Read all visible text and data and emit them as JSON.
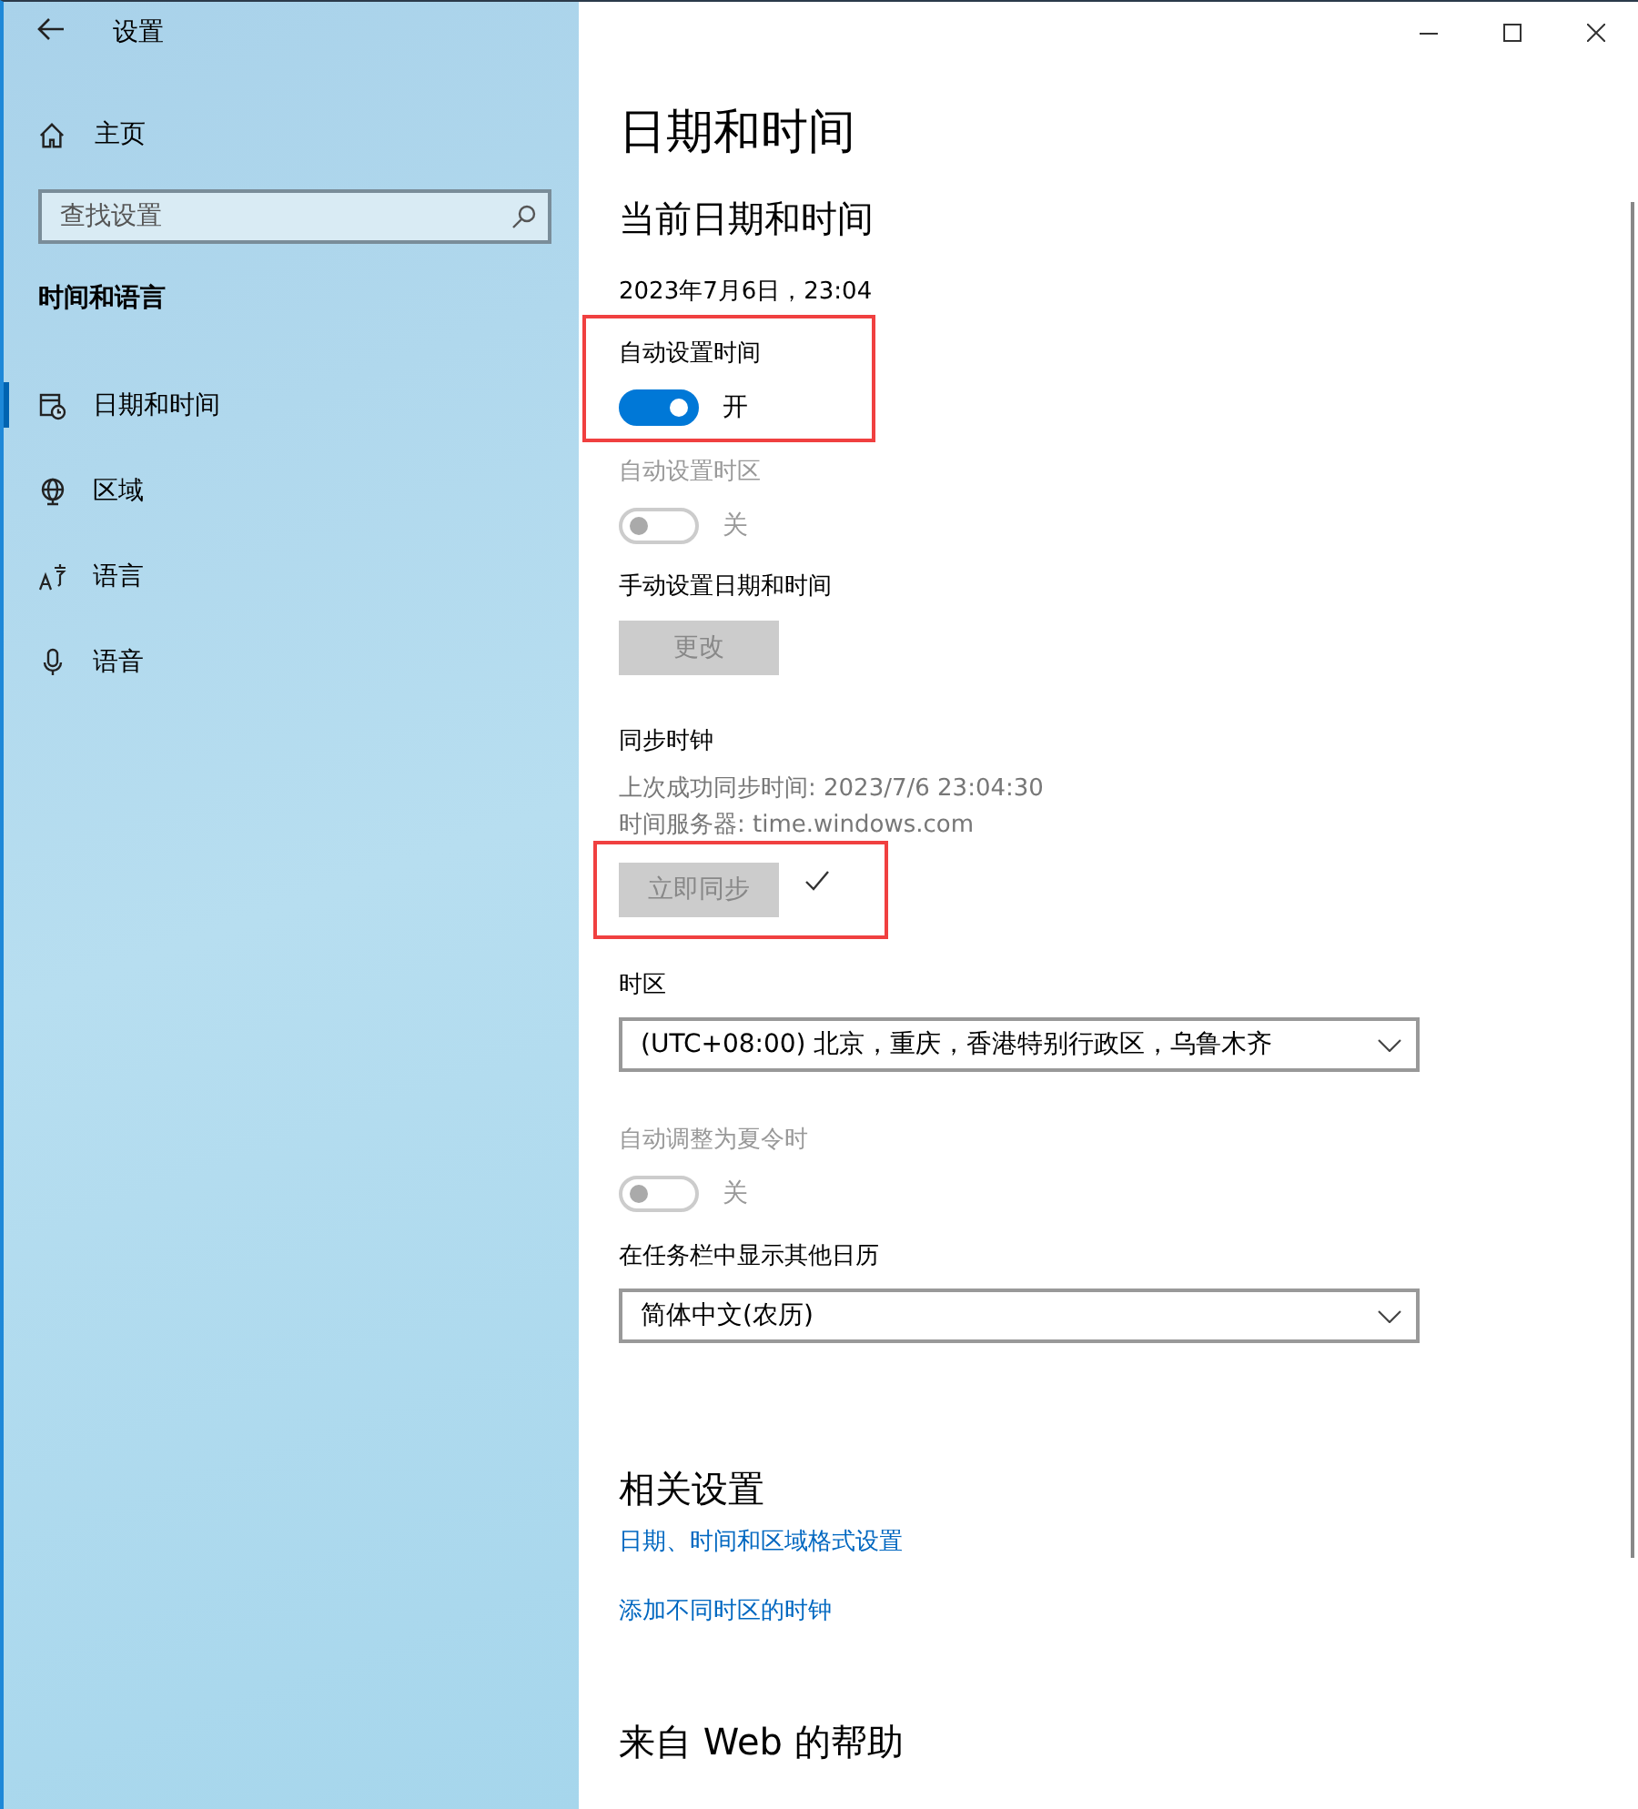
{
  "window": {
    "title": "设置"
  },
  "sidebar": {
    "home": "主页",
    "search": {
      "placeholder": "查找设置"
    },
    "section": "时间和语言",
    "items": [
      {
        "label": "日期和时间",
        "selected": true
      },
      {
        "label": "区域",
        "selected": false
      },
      {
        "label": "语言",
        "selected": false
      },
      {
        "label": "语音",
        "selected": false
      }
    ]
  },
  "page": {
    "title": "日期和时间",
    "section_title": "当前日期和时间",
    "current": "2023年7月6日，23:04",
    "settings": [
      {
        "kind": "toggle",
        "label": "自动设置时间",
        "on": true,
        "disabled": false,
        "state_text": "开",
        "highlighted": true
      },
      {
        "kind": "toggle",
        "label": "自动设置时区",
        "on": false,
        "disabled": true,
        "state_text": "关"
      },
      {
        "kind": "button",
        "label": "手动设置日期和时间",
        "button": "更改",
        "disabled": true
      },
      {
        "kind": "sync",
        "label": "同步时钟",
        "lines": [
          "上次成功同步时间: 2023/7/6 23:04:30",
          "时间服务器: time.windows.com"
        ],
        "button": "立即同步",
        "disabled": true,
        "synced": true,
        "highlighted": true
      },
      {
        "kind": "select",
        "label": "时区",
        "value": "(UTC+08:00) 北京，重庆，香港特别行政区，乌鲁木齐"
      },
      {
        "kind": "toggle",
        "label": "自动调整为夏令时",
        "on": false,
        "disabled": true,
        "state_text": "关"
      },
      {
        "kind": "select",
        "label": "在任务栏中显示其他日历",
        "value": "简体中文(农历)"
      }
    ],
    "related": {
      "title": "相关设置",
      "links": [
        "日期、时间和区域格式设置",
        "添加不同时区的时钟"
      ]
    },
    "help": {
      "title": "来自 Web 的帮助"
    }
  }
}
